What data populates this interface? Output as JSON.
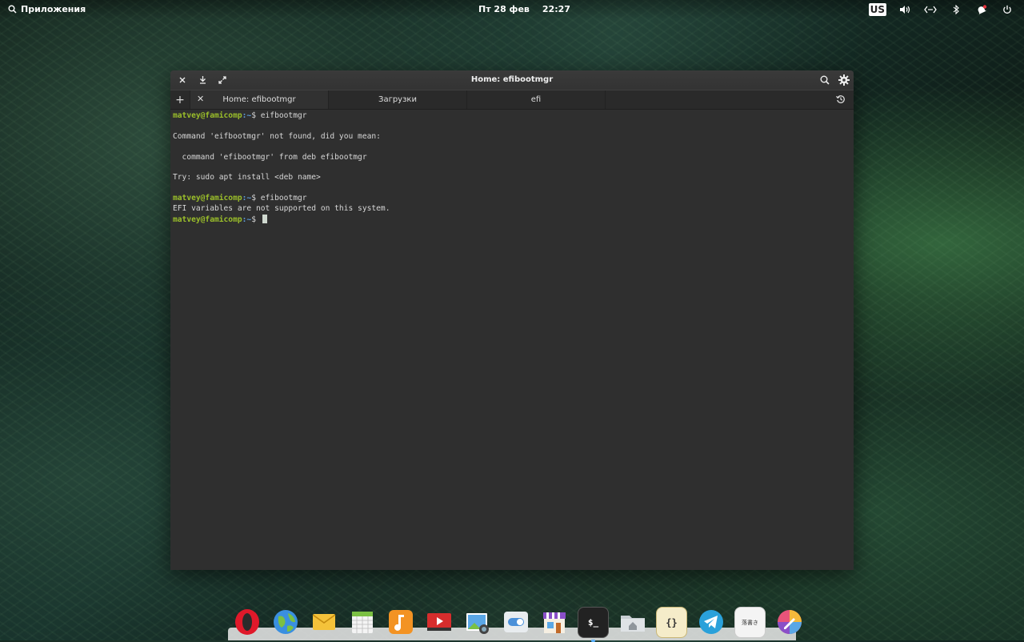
{
  "panel": {
    "apps_label": "Приложения",
    "date": "Пт 28 фев",
    "time": "22:27",
    "keyboard_layout": "US"
  },
  "window": {
    "title": "Home: efibootmgr"
  },
  "tabs": [
    {
      "label": "Home: efibootmgr",
      "active": true
    },
    {
      "label": "Загрузки",
      "active": false
    },
    {
      "label": "efi",
      "active": false
    }
  ],
  "terminal": {
    "user_host": "matvey@famicomp",
    "path": "~",
    "prompt_symbol": "$",
    "lines": [
      "Command 'eifbootmgr' not found, did you mean:",
      "  command 'efibootmgr' from deb efibootmgr",
      "Try: sudo apt install <deb name>",
      "EFI variables are not supported on this system."
    ],
    "commands": [
      " eifbootmgr",
      " efibootmgr"
    ]
  },
  "dock": {
    "apps": [
      "opera",
      "web-browser",
      "mail",
      "calendar",
      "music",
      "videos",
      "photos",
      "switchboard",
      "appcenter",
      "terminal",
      "files",
      "code",
      "telegram",
      "sticky-notes",
      "color-picker"
    ],
    "active_app": "terminal",
    "terminal_glyph": "$_",
    "code_glyph": "{}",
    "notes_glyph": "落書き"
  }
}
